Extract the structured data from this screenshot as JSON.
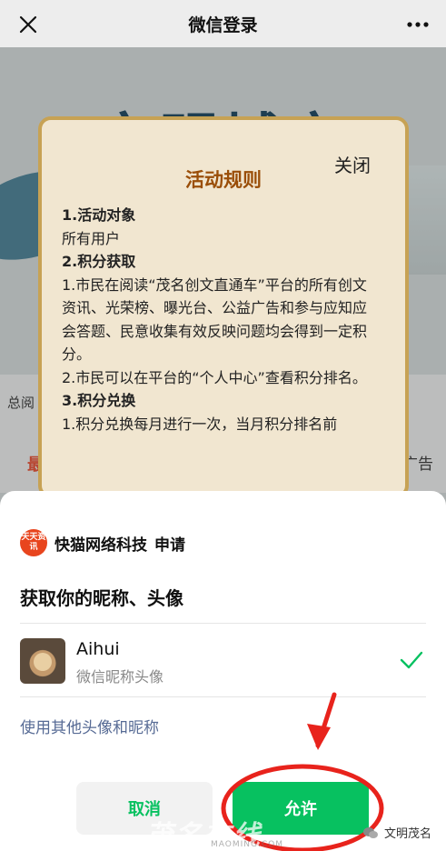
{
  "navbar": {
    "title": "微信登录"
  },
  "background": {
    "banner_title": "文明城市",
    "side_left_text": "总阅",
    "side_right_text": "广告",
    "tab_left_text": "最"
  },
  "rules_modal": {
    "close_label": "关闭",
    "title": "活动规则",
    "lines": [
      "1.活动对象",
      "所有用户",
      "2.积分获取",
      "1.市民在阅读“茂名创文直通车”平台的所有创文资讯、光荣榜、曝光台、公益广告和参与应知应会答题、民意收集有效反映问题均会得到一定积分。",
      "2.市民可以在平台的“个人中心”查看积分排名。",
      "3.积分兑换",
      "1.积分兑换每月进行一次，当月积分排名前"
    ]
  },
  "auth_sheet": {
    "app_logo_text": "天天资讯",
    "app_name": "快猫网络科技",
    "app_action": "申请",
    "permission_title": "获取你的昵称、头像",
    "user": {
      "name": "Aihui",
      "subtitle": "微信昵称头像"
    },
    "alt_link": "使用其他头像和昵称",
    "cancel_label": "取消",
    "allow_label": "允许"
  },
  "watermarks": {
    "center_text": "茂名在线",
    "center_sub": "MAOMING.COM",
    "right_text": "文明茂名"
  },
  "colors": {
    "wechat_green": "#07c160",
    "link_blue": "#576b95",
    "annotation_red": "#e8231c",
    "rules_title": "#9a4e08"
  }
}
